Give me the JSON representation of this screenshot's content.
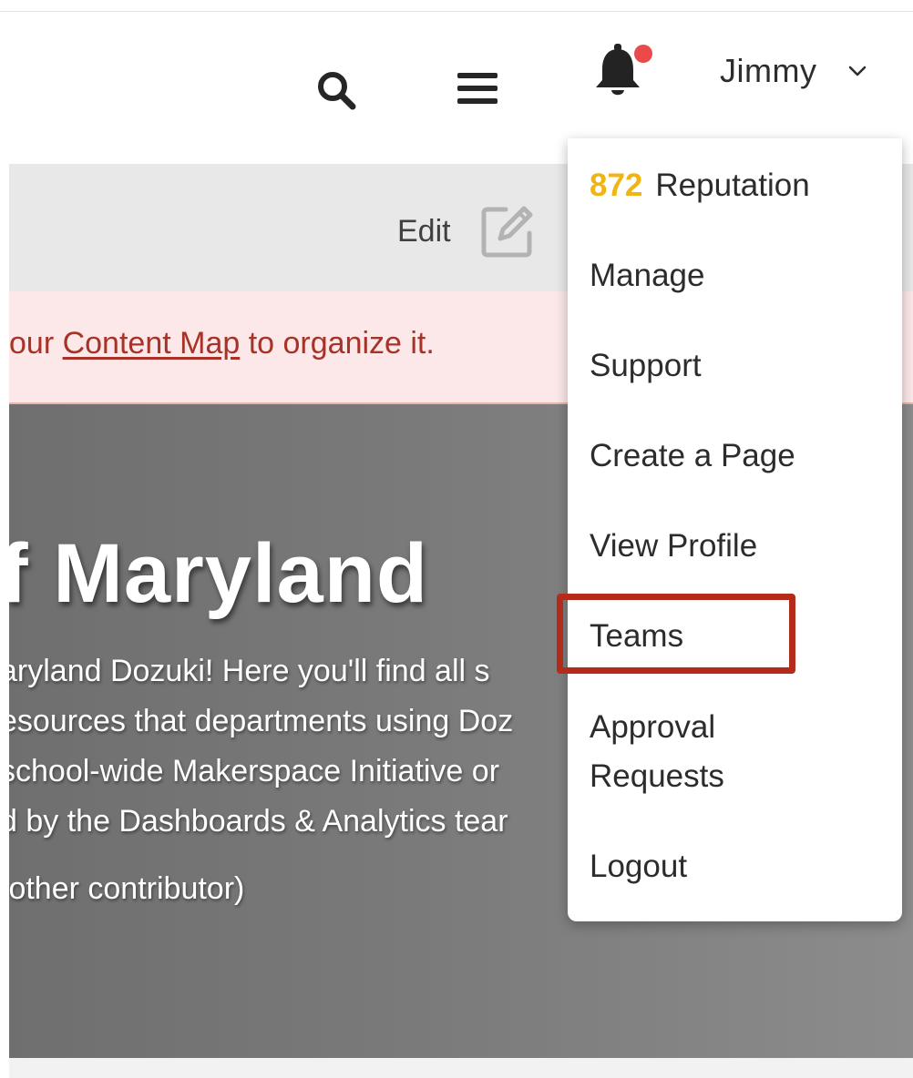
{
  "header": {
    "user_name": "Jimmy",
    "icons": {
      "search": "search-icon",
      "menu": "hamburger-menu-icon",
      "notifications": "bell-icon",
      "user_dropdown": "chevron-down-icon"
    },
    "notification_dot_color": "#e94b4b"
  },
  "edit_bar": {
    "edit_label": "Edit"
  },
  "notice": {
    "prefix": "our ",
    "link_text": "Content Map",
    "suffix": " to organize it."
  },
  "hero": {
    "title": "f Maryland",
    "lines": [
      "aryland Dozuki! Here you'll find all s",
      "esources that departments using Doz",
      "school-wide Makerspace Initiative or",
      "d by the Dashboards & Analytics tear",
      " other contributor)"
    ]
  },
  "user_menu": {
    "reputation_value": "872",
    "reputation_label": "Reputation",
    "items": [
      "Manage",
      "Support",
      "Create a Page",
      "View Profile",
      "Teams",
      "Approval",
      "Requests",
      "Logout"
    ],
    "highlighted_item": "Teams",
    "reputation_color": "#f0b512",
    "highlight_color": "#b22b1b"
  }
}
